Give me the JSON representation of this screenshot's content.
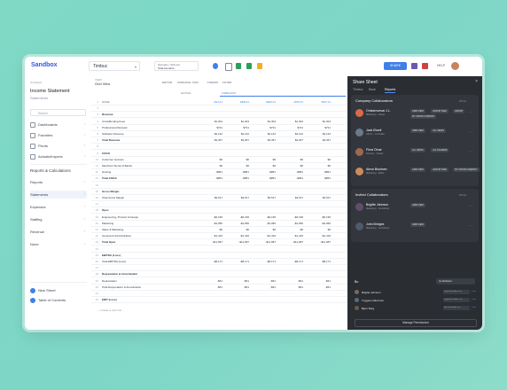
{
  "app": {
    "logo": "Sandbox",
    "workspace": "Timbuc",
    "scenario_label": "Scenario / Sub-cat",
    "scenario_value": "Total scenario",
    "share_label": "SHARE",
    "help_label": "HELP"
  },
  "sidebar": {
    "section_label": "Unshared",
    "title": "Income Statement",
    "subtitle": "Statements",
    "search_placeholder": "Search",
    "items": [
      {
        "label": "Dashboards"
      },
      {
        "label": "Favorites"
      },
      {
        "label": "Pivots"
      },
      {
        "label": "Actuals/Imports"
      }
    ],
    "section2": "Reports & Calculations",
    "items2": [
      {
        "label": "Reports"
      },
      {
        "label": "Statements"
      },
      {
        "label": "Expenses"
      },
      {
        "label": "Staffing"
      },
      {
        "label": "Revenue"
      },
      {
        "label": "None"
      }
    ],
    "new_sheet": "New Sheet",
    "toc": "Table of Contents"
  },
  "grid": {
    "view_label": "VIEW",
    "view_name": "Grid View",
    "tools": [
      "EDITOR",
      "VARIANCE",
      "SUM",
      "FORMAT",
      "FILTER"
    ],
    "actual_label": "ACTUAL",
    "forecast_label": "FORECAST",
    "columns": [
      "NAME",
      "JAN-21",
      "FEB-21",
      "MAR-21",
      "APR-21",
      "MAY-21"
    ],
    "rows": [
      {
        "n": "1",
        "name": "NAME",
        "vals": [
          "JAN-21",
          "FEB-21",
          "MAR-21",
          "APR-21",
          "MAY-21"
        ],
        "hdr": true
      },
      {
        "n": "2",
        "name": "",
        "vals": [
          "",
          "",
          "",
          "",
          ""
        ]
      },
      {
        "n": "3",
        "name": "Revenue",
        "vals": [
          "",
          "",
          "",
          "",
          ""
        ],
        "bold": true
      },
      {
        "n": "4",
        "name": "Crowdfunding Fees",
        "vals": [
          "$1,304",
          "$1,304",
          "$1,304",
          "$1,304",
          "$1,304"
        ]
      },
      {
        "n": "5",
        "name": "Professional Reviews",
        "vals": [
          "$721",
          "$721",
          "$721",
          "$721",
          "$721"
        ]
      },
      {
        "n": "6",
        "name": "Software Revenue",
        "vals": [
          "$2,142",
          "$2,142",
          "$2,142",
          "$2,142",
          "$2,142"
        ]
      },
      {
        "n": "7",
        "name": "Total Revenue",
        "vals": [
          "$4,367",
          "$4,367",
          "$4,367",
          "$4,367",
          "$4,367"
        ],
        "bold": true
      },
      {
        "n": "8",
        "name": "",
        "vals": [
          "",
          "",
          "",
          "",
          ""
        ]
      },
      {
        "n": "9",
        "name": "COGS",
        "vals": [
          "",
          "",
          "",
          "",
          ""
        ],
        "bold": true
      },
      {
        "n": "10",
        "name": "Customer success",
        "vals": [
          "$0",
          "$0",
          "$0",
          "$0",
          "$0"
        ]
      },
      {
        "n": "11",
        "name": "Merchant Stores & Banks",
        "vals": [
          "$0",
          "$0",
          "$0",
          "$0",
          "$0"
        ]
      },
      {
        "n": "12",
        "name": "Hosting",
        "vals": [
          "-$851",
          "-$851",
          "-$851",
          "-$851",
          "-$851"
        ]
      },
      {
        "n": "13",
        "name": "Total COGS",
        "vals": [
          "-$851",
          "-$851",
          "-$851",
          "-$851",
          "-$851"
        ],
        "bold": true
      },
      {
        "n": "14",
        "name": "",
        "vals": [
          "",
          "",
          "",
          "",
          ""
        ]
      },
      {
        "n": "15",
        "name": "Gross Margin",
        "vals": [
          "",
          "",
          "",
          "",
          ""
        ],
        "bold": true
      },
      {
        "n": "16",
        "name": "Total Gross Margin",
        "vals": [
          "$3,517",
          "$3,517",
          "$3,517",
          "$3,517",
          "$3,517"
        ]
      },
      {
        "n": "17",
        "name": "",
        "vals": [
          "",
          "",
          "",
          "",
          ""
        ]
      },
      {
        "n": "18",
        "name": "Opex",
        "vals": [
          "",
          "",
          "",
          "",
          ""
        ],
        "bold": true
      },
      {
        "n": "19",
        "name": "Engineering, Product & Design",
        "vals": [
          "-$6,195",
          "-$6,195",
          "-$6,195",
          "-$6,195",
          "-$6,195"
        ]
      },
      {
        "n": "20",
        "name": "Marketing",
        "vals": [
          "-$4,050",
          "-$4,050",
          "-$4,050",
          "-$4,050",
          "-$4,050"
        ]
      },
      {
        "n": "21",
        "name": "Sales & Marketing",
        "vals": [
          "$0",
          "$0",
          "$0",
          "$0",
          "$0"
        ]
      },
      {
        "n": "22",
        "name": "General & Administrative",
        "vals": [
          "-$1,416",
          "-$1,416",
          "-$1,416",
          "-$1,416",
          "-$1,416"
        ]
      },
      {
        "n": "23",
        "name": "Total Opex",
        "vals": [
          "-$11,687",
          "-$11,687",
          "-$11,687",
          "-$11,687",
          "-$11,687"
        ],
        "bold": true
      },
      {
        "n": "24",
        "name": "",
        "vals": [
          "",
          "",
          "",
          "",
          ""
        ]
      },
      {
        "n": "25",
        "name": "EBITDA (Loss)",
        "vals": [
          "",
          "",
          "",
          "",
          ""
        ],
        "bold": true
      },
      {
        "n": "26",
        "name": "Total EBITDA (Loss)",
        "vals": [
          "-$8,171",
          "-$8,171",
          "-$8,171",
          "-$8,171",
          "-$8,171"
        ]
      },
      {
        "n": "27",
        "name": "",
        "vals": [
          "",
          "",
          "",
          "",
          ""
        ]
      },
      {
        "n": "28",
        "name": "Depreciation & Amortization",
        "vals": [
          "",
          "",
          "",
          "",
          ""
        ],
        "bold": true
      },
      {
        "n": "29",
        "name": "Depreciation",
        "vals": [
          "-$51",
          "-$51",
          "-$51",
          "-$51",
          "-$51"
        ]
      },
      {
        "n": "30",
        "name": "Total Depreciation & Amortization",
        "vals": [
          "-$51",
          "-$51",
          "-$51",
          "-$51",
          "-$51"
        ]
      },
      {
        "n": "31",
        "name": "",
        "vals": [
          "",
          "",
          "",
          "",
          ""
        ]
      },
      {
        "n": "32",
        "name": "EBIT (Loss)",
        "vals": [
          "",
          "",
          "",
          "",
          ""
        ],
        "bold": true
      }
    ],
    "footer": "+ Create a new row"
  },
  "panel": {
    "title": "Share Sheet",
    "tabs": [
      "Timbuc",
      "Base",
      "Reports"
    ],
    "company_title": "Company Collaborators",
    "company_sub": "ROLE",
    "company": [
      {
        "name": "Omkarnurwar J.L.",
        "role": "Marketing · Owner",
        "pills": [
          "GRID VIEW",
          "GROUP VIEW",
          "GROUP",
          "MY CROSS COMPANY"
        ],
        "color": "#d86a4a"
      },
      {
        "name": "Jack Elwell",
        "role": "Admin · Controller",
        "pills": [
          "GRID VIEW",
          "ALL VIEWS"
        ],
        "color": "#6a7a8c"
      },
      {
        "name": "Flora Omar",
        "role": "Finance · Viewer",
        "pills": [
          "ALL VIEWS",
          "ALL FOLDERS"
        ],
        "color": "#9c6a4f"
      },
      {
        "name": "Alexa Blodman",
        "role": "Marketing · Editor",
        "pills": [
          "GRID VIEW",
          "GROUP VIEW",
          "MY CROSS COMPANY"
        ],
        "color": "#c98c5e"
      }
    ],
    "invited_title": "Invited Collaborators",
    "invited_sub": "ROLE",
    "invited": [
      {
        "name": "Brigitte Johnson",
        "role": "Marketing · Contributor",
        "pills": [
          "GRID VIEW"
        ],
        "color": "#5f4f6a"
      },
      {
        "name": "John Bridges",
        "role": "Marketing · Contributor",
        "pills": [
          "GRID VIEW"
        ],
        "color": "#4f5a6a"
      }
    ],
    "bottom_label": "Bo",
    "bottom_select": "Contributor",
    "bottom_rows": [
      {
        "name": "Brigitte Johnson",
        "email": "brigitte@sandbox.com",
        "tag": "Invite"
      },
      {
        "name": "Tryggve Halvorsen",
        "email": "tryggve@sandbox.com",
        "tag": "Invite"
      },
      {
        "name": "Bjorn Borg",
        "email": "bjorn@sandbox.com",
        "tag": "Invite"
      }
    ],
    "manage_label": "Manage Permissions"
  }
}
